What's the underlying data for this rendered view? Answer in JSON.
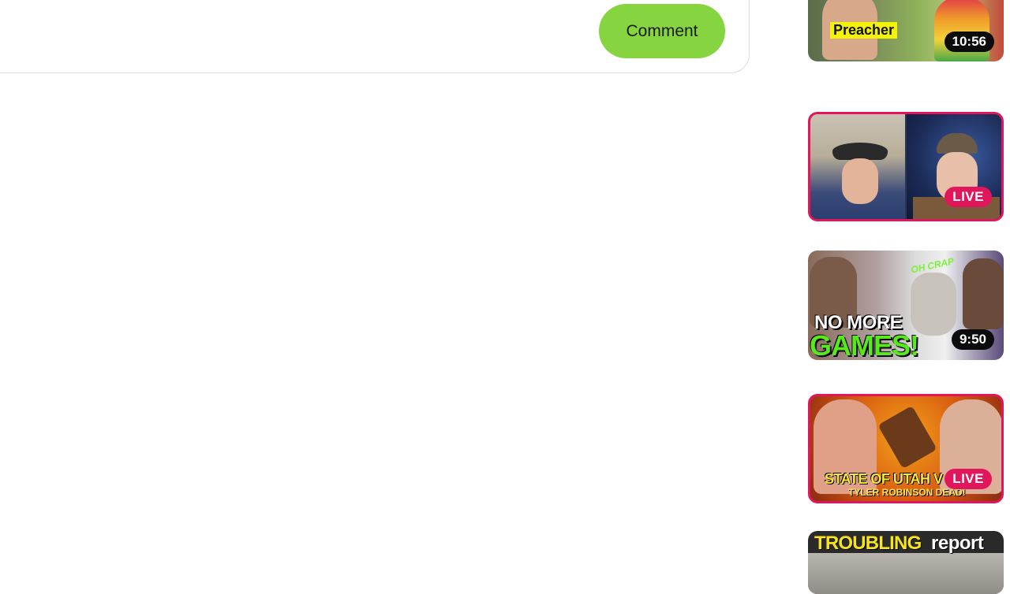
{
  "comment": {
    "button_label": "Comment"
  },
  "sidebar": {
    "videos": [
      {
        "caption": "Preacher",
        "duration": "10:56",
        "live": false
      },
      {
        "badge": "LIVE",
        "live": true
      },
      {
        "caption_small": "OH CRAP",
        "caption_line1": "NO MORE",
        "caption_line2": "GAMES!",
        "duration": "9:50",
        "live": false
      },
      {
        "caption_line1": "STATE OF UTAH V",
        "caption_line2": "TYLER ROBINSON DEAD!",
        "badge": "LIVE",
        "live": true
      },
      {
        "caption_word1": "TROUBLING",
        "caption_word2": "report"
      }
    ]
  },
  "colors": {
    "comment_button": "#85d440",
    "live_accent": "#e2165a"
  }
}
